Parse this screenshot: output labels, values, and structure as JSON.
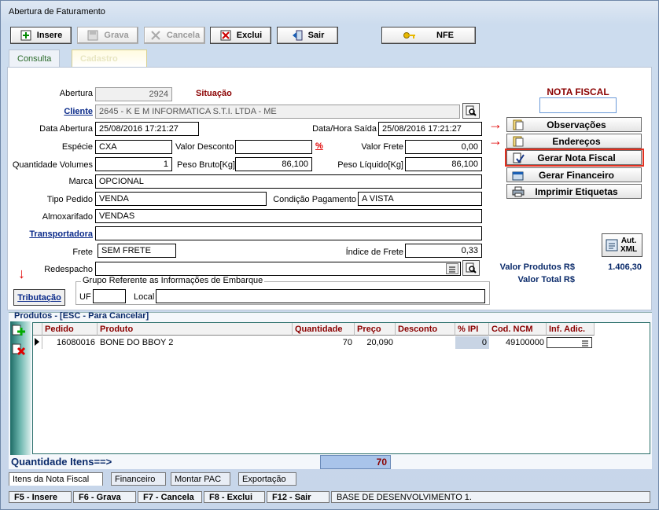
{
  "window": {
    "title": "Abertura de Faturamento"
  },
  "toolbar": {
    "insere": "Insere",
    "grava": "Grava",
    "cancela": "Cancela",
    "exclui": "Exclui",
    "sair": "Sair",
    "nfe": "NFE"
  },
  "top_tabs": {
    "consulta": "Consulta",
    "cadastro": "Cadastro"
  },
  "form": {
    "abertura_label": "Abertura",
    "abertura_value": "2924",
    "situacao_label": "Situação",
    "cliente_label": "Cliente",
    "cliente_value": "2645 - K E M INFORMATICA S.T.I. LTDA - ME",
    "data_abertura_label": "Data Abertura",
    "data_abertura_value": "25/08/2016 17:21:27",
    "data_saida_label": "Data/Hora Saída",
    "data_saida_value": "25/08/2016 17:21:27",
    "especie_label": "Espécie",
    "especie_value": "CXA",
    "valor_desconto_label": "Valor Desconto",
    "valor_desconto_value": "",
    "percent": "%",
    "valor_frete_label": "Valor Frete",
    "valor_frete_value": "0,00",
    "qtd_volumes_label": "Quantidade Volumes",
    "qtd_volumes_value": "1",
    "peso_bruto_label": "Peso Bruto[Kg]",
    "peso_bruto_value": "86,100",
    "peso_liquido_label": "Peso Líquido[Kg]",
    "peso_liquido_value": "86,100",
    "marca_label": "Marca",
    "marca_value": "OPCIONAL",
    "tipo_pedido_label": "Tipo Pedido",
    "tipo_pedido_value": "VENDA",
    "condicao_label": "Condição Pagamento",
    "condicao_value": "A VISTA",
    "almoxarifado_label": "Almoxarifado",
    "almoxarifado_value": "VENDAS",
    "transportadora_label": "Transportadora",
    "transportadora_value": "",
    "frete_label": "Frete",
    "frete_value": "SEM FRETE",
    "indice_frete_label": "Índice de Frete",
    "indice_frete_value": "0,33",
    "redespacho_label": "Redespacho",
    "redespacho_value": "",
    "tributacao": "Tributação",
    "grupo_label": "Grupo Referente as Informações de Embarque",
    "uf_label": "UF",
    "local_label": "Local"
  },
  "side": {
    "nota_fiscal_label": "NOTA FISCAL",
    "nota_fiscal_value": "",
    "observacoes": "Observações",
    "enderecos": "Endereços",
    "gerar_nota": "Gerar Nota Fiscal",
    "gerar_financeiro": "Gerar Financeiro",
    "imprimir_etiquetas": "Imprimir Etiquetas",
    "aut_xml_1": "Aut.",
    "aut_xml_2": "XML",
    "valor_produtos_label": "Valor Produtos R$",
    "valor_produtos_value": "1.406,30",
    "valor_total_label": "Valor Total R$"
  },
  "produtos": {
    "title": "Produtos - [ESC - Para Cancelar]",
    "columns": [
      "Pedido",
      "Produto",
      "Quantidade",
      "Preço",
      "Desconto",
      "% IPI",
      "Cod. NCM",
      "Inf. Adic."
    ],
    "rows": [
      {
        "pedido": "16080016",
        "produto": "BONE DO BBOY 2",
        "quantidade": "70",
        "preco": "20,090",
        "desconto": "",
        "ipi": "0",
        "ncm": "49100000",
        "inf": ""
      }
    ],
    "qtd_itens_label": "Quantidade Itens==>",
    "qtd_itens_value": "70"
  },
  "bottom_tabs": [
    "Itens da Nota Fiscal",
    "Financeiro",
    "Montar PAC",
    "Exportação"
  ],
  "status": {
    "f5": "F5 - Insere",
    "f6": "F6 - Grava",
    "f7": "F7 - Cancela",
    "f8": "F8 - Exclui",
    "f12": "F12 - Sair",
    "message": "BASE DE DESENVOLVIMENTO 1."
  },
  "colors": {
    "accent_red": "#e00000",
    "label_darkred": "#8a0000",
    "link_blue": "#0a2a8a",
    "grid_border": "#2a6f6a",
    "highlight": "#a9c4ea"
  }
}
